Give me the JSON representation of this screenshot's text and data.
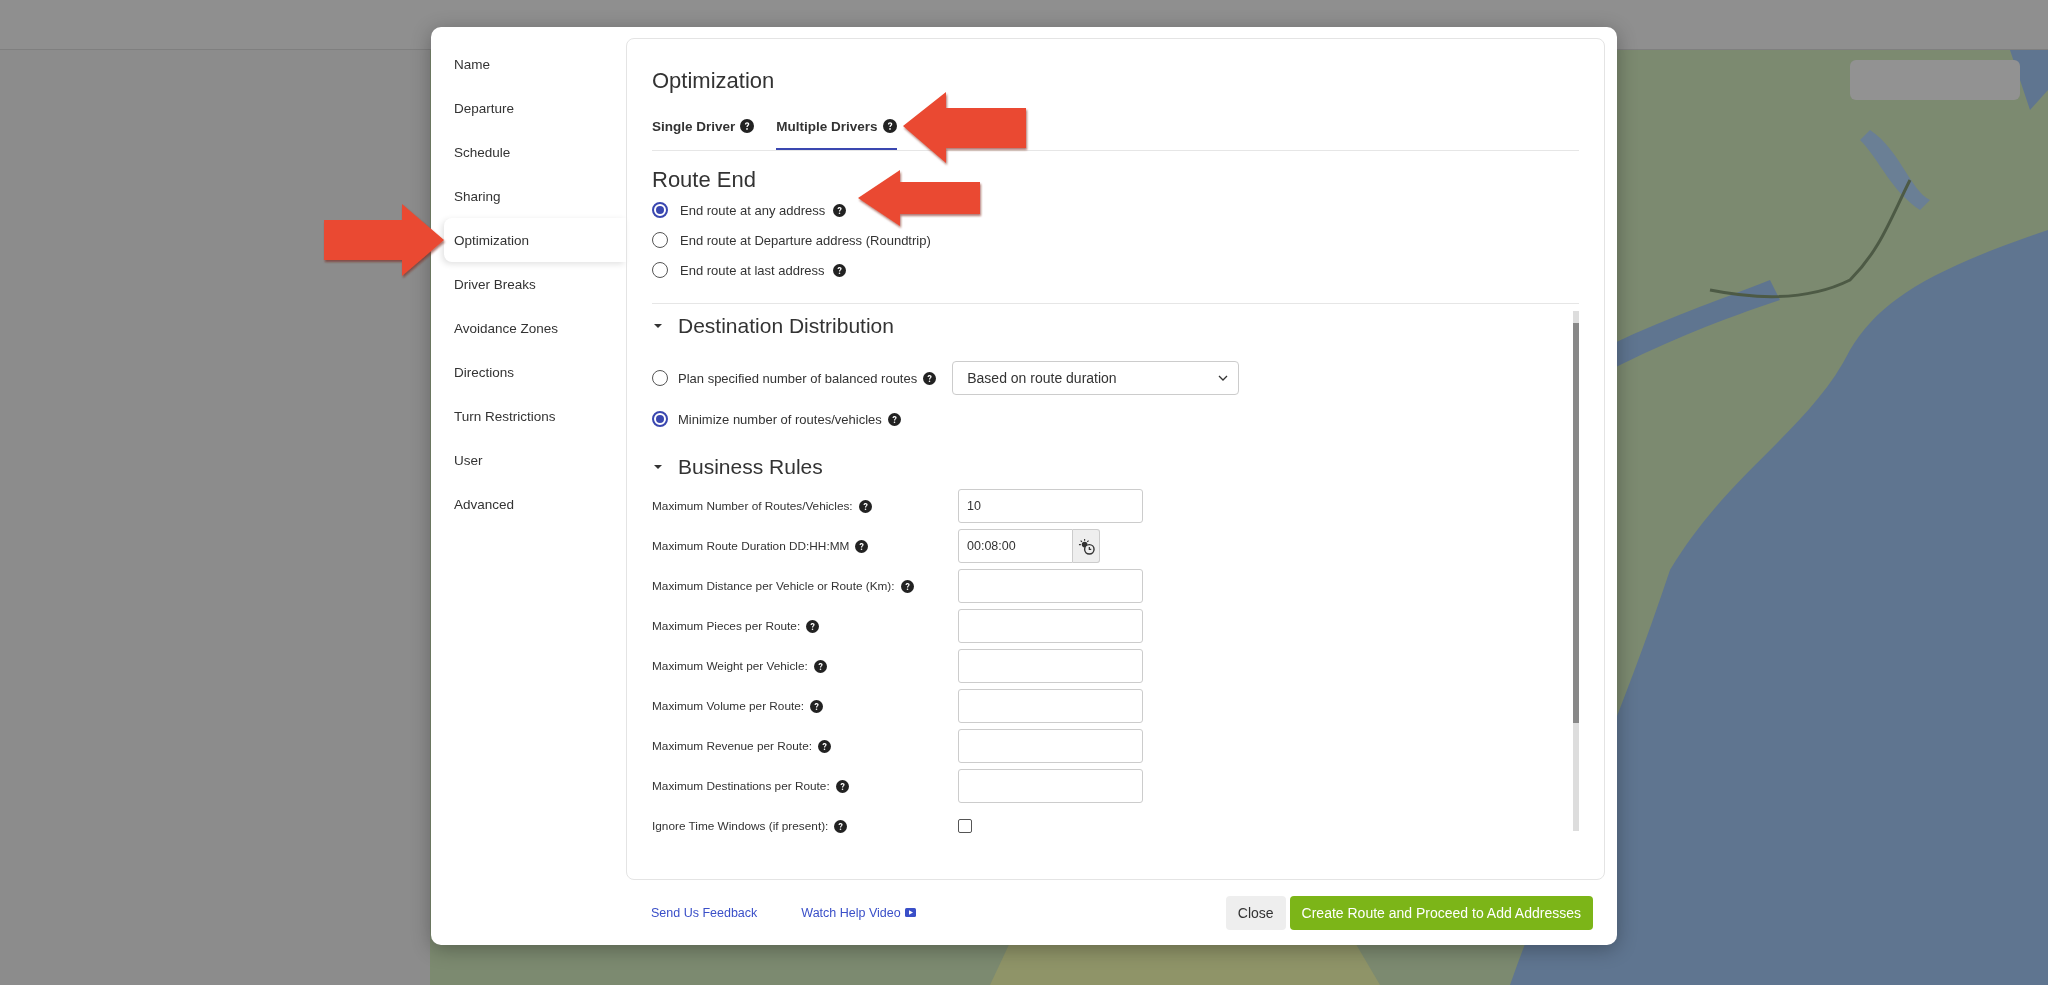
{
  "modal": {
    "sidebar": {
      "items": [
        {
          "label": "Name",
          "selected": false
        },
        {
          "label": "Departure",
          "selected": false
        },
        {
          "label": "Schedule",
          "selected": false
        },
        {
          "label": "Sharing",
          "selected": false
        },
        {
          "label": "Optimization",
          "selected": true
        },
        {
          "label": "Driver Breaks",
          "selected": false
        },
        {
          "label": "Avoidance Zones",
          "selected": false
        },
        {
          "label": "Directions",
          "selected": false
        },
        {
          "label": "Turn Restrictions",
          "selected": false
        },
        {
          "label": "User",
          "selected": false
        },
        {
          "label": "Advanced",
          "selected": false
        }
      ]
    },
    "title": "Optimization",
    "tabs": [
      {
        "label": "Single Driver",
        "selected": false
      },
      {
        "label": "Multiple Drivers",
        "selected": true
      }
    ],
    "route_end": {
      "heading": "Route End",
      "options": [
        {
          "label": "End route at any address",
          "selected": true,
          "help": true
        },
        {
          "label": "End route at Departure address (Roundtrip)",
          "selected": false,
          "help": false
        },
        {
          "label": "End route at last address",
          "selected": false,
          "help": true
        }
      ]
    },
    "destination_distribution": {
      "heading": "Destination Distribution",
      "expanded": true,
      "options": [
        {
          "label": "Plan specified number of balanced routes",
          "selected": false,
          "select_value": "Based on route duration"
        },
        {
          "label": "Minimize number of routes/vehicles",
          "selected": true
        }
      ]
    },
    "business_rules": {
      "heading": "Business Rules",
      "expanded": true,
      "fields": [
        {
          "label": "Maximum Number of Routes/Vehicles:",
          "kind": "text",
          "value": "10"
        },
        {
          "label": "Maximum Route Duration DD:HH:MM",
          "kind": "time",
          "value": "00:08:00"
        },
        {
          "label": "Maximum Distance per Vehicle or Route (Km):",
          "kind": "text"
        },
        {
          "label": "Maximum Pieces per Route:",
          "kind": "text"
        },
        {
          "label": "Maximum Weight per Vehicle:",
          "kind": "text"
        },
        {
          "label": "Maximum Volume per Route:",
          "kind": "text"
        },
        {
          "label": "Maximum Revenue per Route:",
          "kind": "text"
        },
        {
          "label": "Maximum Destinations per Route:",
          "kind": "text"
        },
        {
          "label": "Ignore Time Windows (if present):",
          "kind": "checkbox",
          "checked": false
        }
      ]
    },
    "footer": {
      "links": [
        {
          "label": "Send Us Feedback",
          "kind": "plain"
        },
        {
          "label": "Watch Help Video",
          "kind": "video"
        }
      ],
      "buttons": [
        {
          "label": "Close",
          "kind": "secondary"
        },
        {
          "label": "Create Route and Proceed to Add Addresses",
          "kind": "primary"
        }
      ]
    }
  }
}
